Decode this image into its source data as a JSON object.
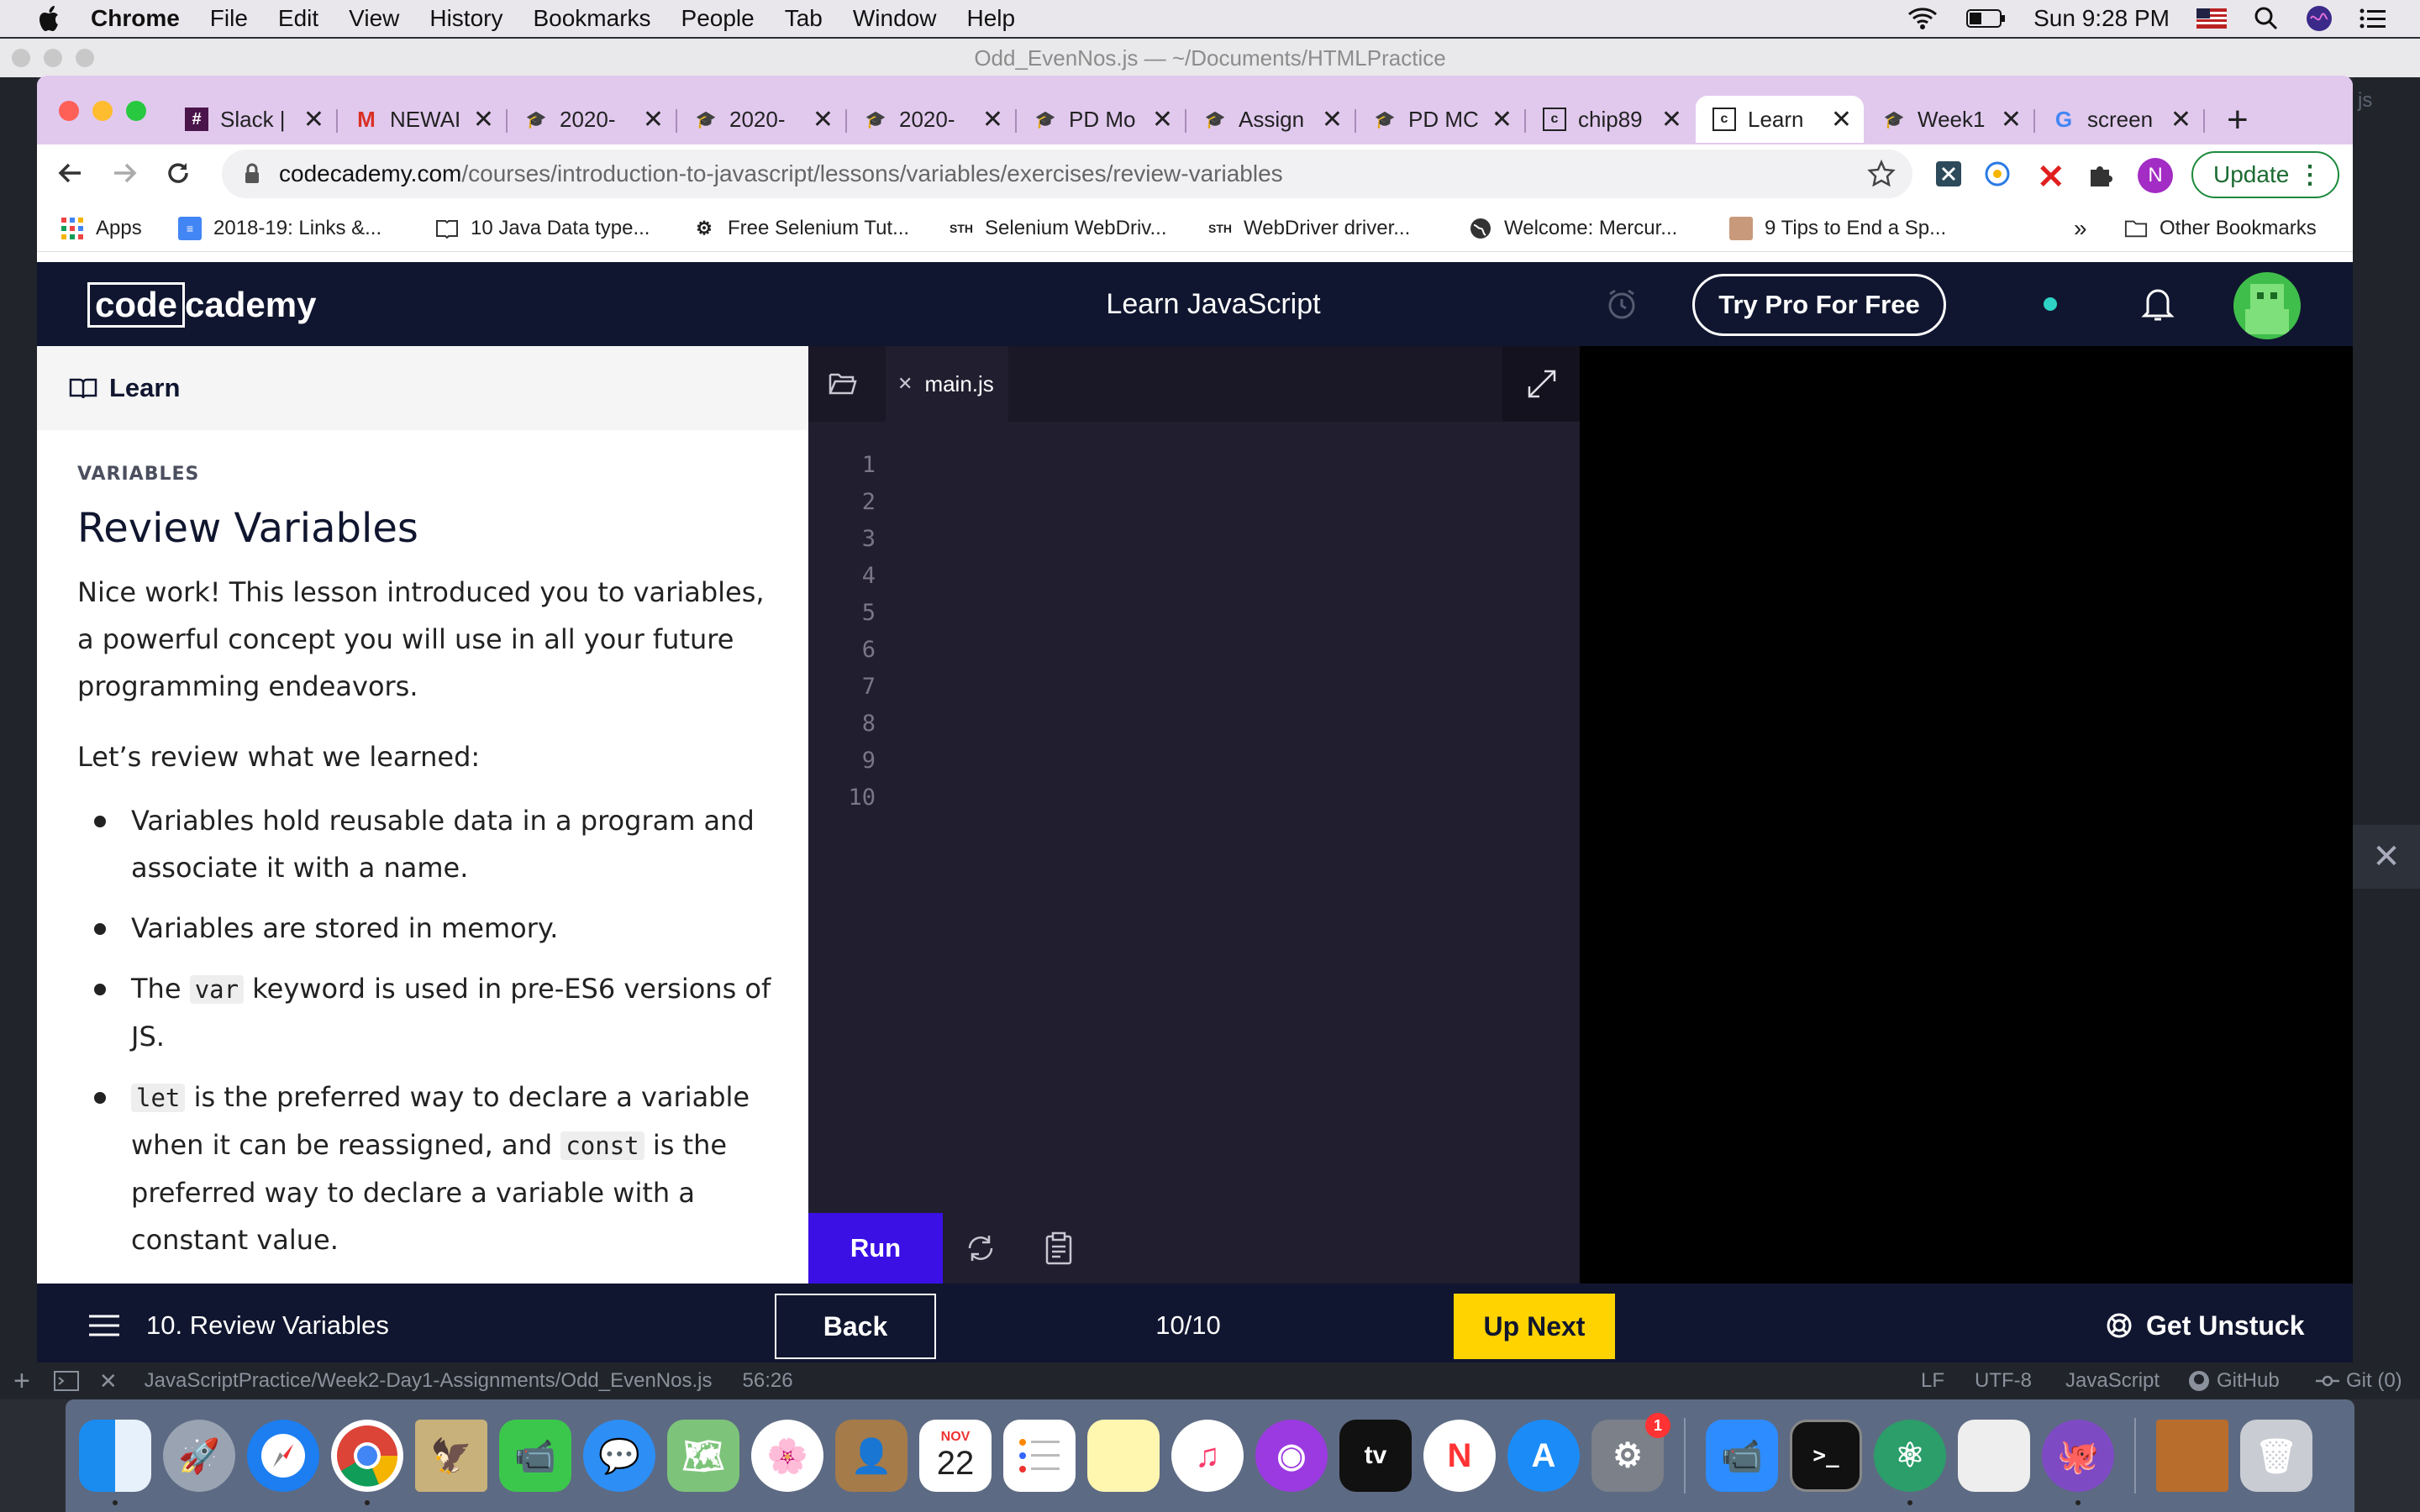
{
  "menubar": {
    "app": "Chrome",
    "items": [
      "File",
      "Edit",
      "View",
      "History",
      "Bookmarks",
      "People",
      "Tab",
      "Window",
      "Help"
    ],
    "clock": "Sun 9:28 PM"
  },
  "atom": {
    "window_title": "Odd_EvenNos.js — ~/Documents/HTMLPractice",
    "status_path": "JavaScriptPractice/Week2-Day1-Assignments/Odd_EvenNos.js",
    "cursor": "56:26",
    "line_ending": "LF",
    "encoding": "UTF-8",
    "grammar": "JavaScript",
    "github": "GitHub",
    "git": "Git (0)",
    "side_tab_fragment": "js"
  },
  "tabs": [
    {
      "label": "Slack |",
      "icon": "slack-icon"
    },
    {
      "label": "NEWAI",
      "icon": "gmail-icon"
    },
    {
      "label": "2020-",
      "icon": "cap-icon"
    },
    {
      "label": "2020-",
      "icon": "cap-icon"
    },
    {
      "label": "2020-",
      "icon": "cap-icon"
    },
    {
      "label": "PD Mo",
      "icon": "cap-icon"
    },
    {
      "label": "Assign",
      "icon": "cap-icon"
    },
    {
      "label": "PD MC",
      "icon": "cap-icon"
    },
    {
      "label": "chip89",
      "icon": "codecademy-icon"
    },
    {
      "label": "Learn",
      "icon": "codecademy-icon",
      "active": true
    },
    {
      "label": "Week1",
      "icon": "cap-icon"
    },
    {
      "label": "screen",
      "icon": "google-icon"
    }
  ],
  "address": {
    "domain": "codecademy.com",
    "path": "/courses/introduction-to-javascript/lessons/variables/exercises/review-variables"
  },
  "profile_initial": "N",
  "update_label": "Update",
  "bookmarks": [
    "Apps",
    "2018-19: Links &...",
    "10 Java Data type...",
    "Free Selenium Tut...",
    "Selenium WebDriv...",
    "WebDriver driver...",
    "Welcome: Mercur...",
    "9 Tips to End a Sp..."
  ],
  "bookmarks_overflow": "»",
  "other_bookmarks": "Other Bookmarks",
  "codecademy": {
    "logo_left": "code",
    "logo_right": "cademy",
    "title": "Learn JavaScript",
    "try_pro": "Try Pro For Free"
  },
  "learn": {
    "header": "Learn",
    "kicker": "VARIABLES",
    "heading": "Review Variables",
    "intro": "Nice work! This lesson introduced you to variables, a powerful concept you will use in all your future programming endeavors.",
    "review": "Let’s review what we learned:",
    "b1": "Variables hold reusable data in a program and associate it with a name.",
    "b2": "Variables are stored in memory.",
    "b3_pre": "The ",
    "b3_code": "var",
    "b3_post": " keyword is used in pre-ES6 versions of JS.",
    "b4_code1": "let",
    "b4_mid": " is the preferred way to declare a variable when it can be reassigned, and ",
    "b4_code2": "const",
    "b4_post": " is the preferred way to declare a variable with a constant value."
  },
  "editor": {
    "file": "main.js",
    "line_numbers": [
      "1",
      "2",
      "3",
      "4",
      "5",
      "6",
      "7",
      "8",
      "9",
      "10"
    ],
    "run": "Run"
  },
  "footer": {
    "lesson": "10. Review Variables",
    "back": "Back",
    "progress": "10/10",
    "up_next": "Up Next",
    "get_unstuck": "Get Unstuck"
  },
  "dock": {
    "calendar_month": "NOV",
    "calendar_day": "22",
    "badge": "1"
  },
  "colors": {
    "cc_navy": "#10162f",
    "run_purple": "#3a10e5",
    "up_next_yellow": "#ffd300",
    "tab_strip": "#e1c9ee"
  }
}
